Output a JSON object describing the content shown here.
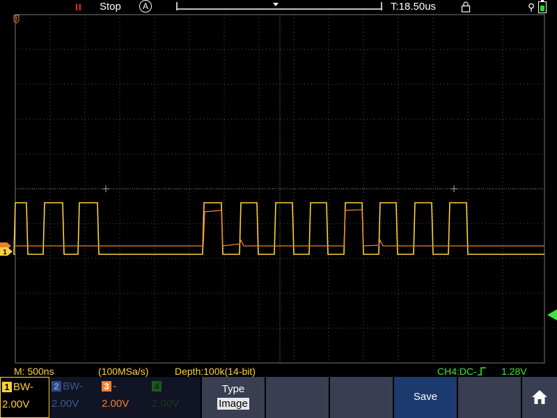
{
  "topbar": {
    "run_icon": "II",
    "run_state": "Stop",
    "trigger_mode_icon": "A",
    "trigger_time": "T:18.50us"
  },
  "statusbar": {
    "memory": "M: 500ns",
    "sample_rate": "(100MSa/s)",
    "depth": "Depth:100k(14-bit)",
    "trigger_source": "CH4:DC-",
    "trigger_level": "1.28V"
  },
  "channels": [
    {
      "num": "1",
      "label": "BW-",
      "scale": "2.00V",
      "color": "#ffd23a",
      "active": true
    },
    {
      "num": "2",
      "label": "BW-",
      "scale": "2.00V",
      "color": "#3c5a8c",
      "active": false
    },
    {
      "num": "3",
      "label": "-",
      "scale": "2.00V",
      "color": "#f08030",
      "active": false
    },
    {
      "num": "4",
      "label": "",
      "scale": "2.00V",
      "color": "#1a3a1a",
      "active": false
    }
  ],
  "softkeys": {
    "type_title": "Type",
    "type_value": "Image",
    "save": "Save",
    "home_icon": "home-icon"
  },
  "markers": {
    "trigger_marker": "T",
    "ch1_marker": "1"
  },
  "colors": {
    "ch1": "#ffd23a",
    "ch3": "#f08030",
    "ch4": "#39e639",
    "grid": "#5a5a5a"
  }
}
